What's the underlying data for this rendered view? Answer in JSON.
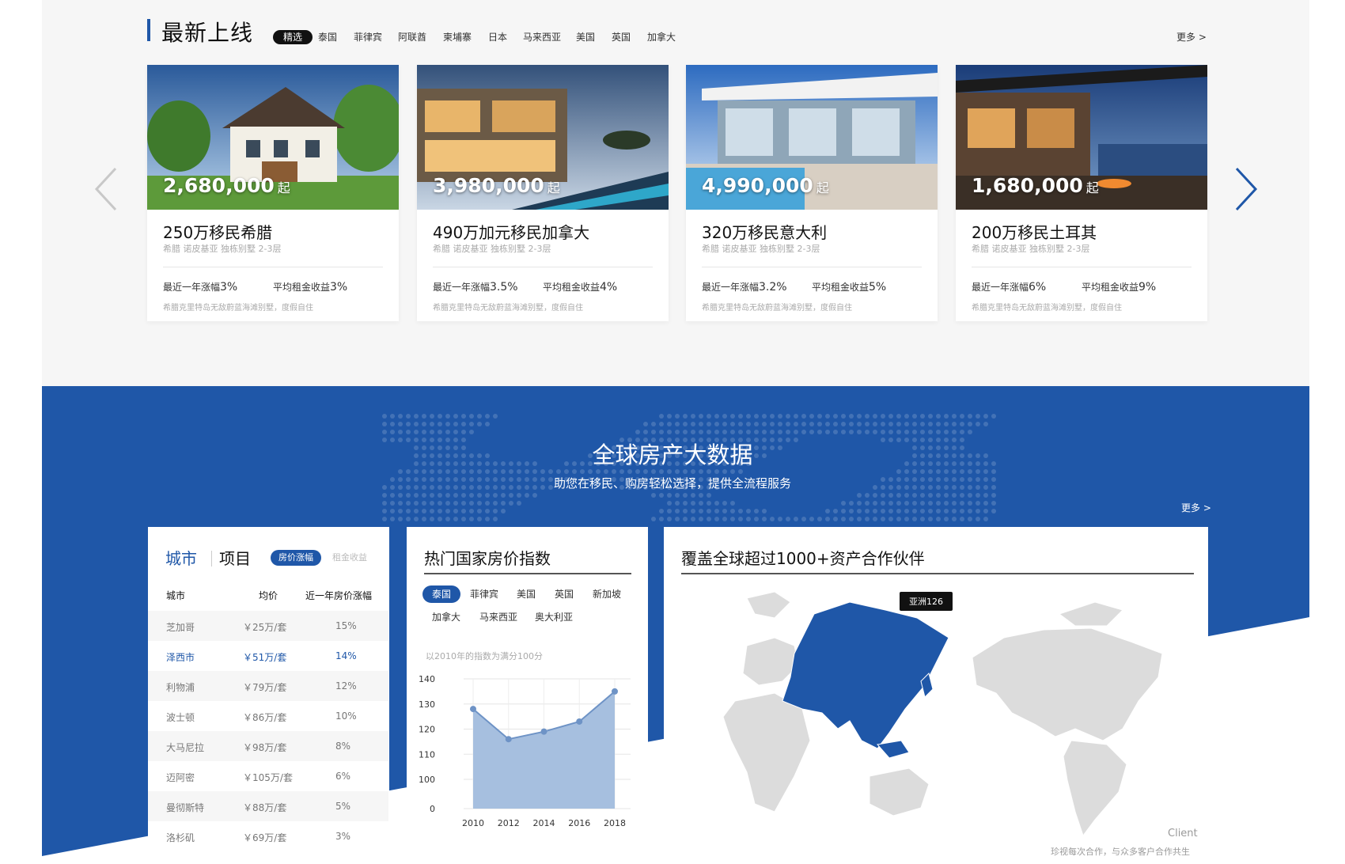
{
  "header": {
    "title": "最新上线",
    "tabs": [
      {
        "label": "精选",
        "active": true
      },
      {
        "label": "泰国"
      },
      {
        "label": "菲律宾"
      },
      {
        "label": "阿联酋"
      },
      {
        "label": "柬埔寨"
      },
      {
        "label": "日本"
      },
      {
        "label": "马来西亚"
      },
      {
        "label": "美国"
      },
      {
        "label": "英国"
      },
      {
        "label": "加拿大"
      }
    ],
    "more": "更多 >"
  },
  "carousel": {
    "prev_icon": "chevron-left-icon",
    "next_icon": "chevron-right-icon",
    "cards": [
      {
        "price": "2,680,000",
        "price_suffix": "起",
        "title": "250万移民希腊",
        "subtitle": "希腊 诺皮基亚 独栋别墅 2-3层",
        "stat1_label": "最近一年涨幅",
        "stat1_value": "3%",
        "stat2_label": "平均租金收益",
        "stat2_value": "3%",
        "note": "希腊克里特岛无敌蔚蓝海滩别墅，度假自住"
      },
      {
        "price": "3,980,000",
        "price_suffix": "起",
        "title": "490万加元移民加拿大",
        "subtitle": "希腊 诺皮基亚 独栋别墅 2-3层",
        "stat1_label": "最近一年涨幅",
        "stat1_value": "3.5%",
        "stat2_label": "平均租金收益",
        "stat2_value": "4%",
        "note": "希腊克里特岛无敌蔚蓝海滩别墅，度假自住"
      },
      {
        "price": "4,990,000",
        "price_suffix": "起",
        "title": "320万移民意大利",
        "subtitle": "希腊 诺皮基亚 独栋别墅 2-3层",
        "stat1_label": "最近一年涨幅",
        "stat1_value": "3.2%",
        "stat2_label": "平均租金收益",
        "stat2_value": "5%",
        "note": "希腊克里特岛无敌蔚蓝海滩别墅，度假自住"
      },
      {
        "price": "1,680,000",
        "price_suffix": "起",
        "title": "200万移民土耳其",
        "subtitle": "希腊 诺皮基亚 独栋别墅 2-3层",
        "stat1_label": "最近一年涨幅",
        "stat1_value": "6%",
        "stat2_label": "平均租金收益",
        "stat2_value": "9%",
        "note": "希腊克里特岛无敌蔚蓝海滩别墅，度假自住"
      }
    ]
  },
  "bigdata": {
    "title": "全球房产大数据",
    "subtitle": "助您在移民、购房轻松选择，提供全流程服务",
    "more": "更多 >"
  },
  "city_panel": {
    "tab_city": "城市",
    "tab_project": "项目",
    "toggle_active": "房价涨幅",
    "toggle_inactive": "租金收益",
    "columns": [
      "城市",
      "均价",
      "近一年房价涨幅"
    ],
    "rows": [
      {
        "city": "芝加哥",
        "price": "￥25万/套",
        "growth": "15%"
      },
      {
        "city": "泽西市",
        "price": "￥51万/套",
        "growth": "14%"
      },
      {
        "city": "利物浦",
        "price": "￥79万/套",
        "growth": "12%"
      },
      {
        "city": "波士顿",
        "price": "￥86万/套",
        "growth": "10%"
      },
      {
        "city": "大马尼拉",
        "price": "￥98万/套",
        "growth": "8%"
      },
      {
        "city": "迈阿密",
        "price": "￥105万/套",
        "growth": "6%"
      },
      {
        "city": "曼彻斯特",
        "price": "￥88万/套",
        "growth": "5%"
      },
      {
        "city": "洛杉矶",
        "price": "￥69万/套",
        "growth": "3%"
      }
    ]
  },
  "index_panel": {
    "title": "热门国家房价指数",
    "tabs": [
      {
        "label": "泰国",
        "active": true
      },
      {
        "label": "菲律宾"
      },
      {
        "label": "美国"
      },
      {
        "label": "英国"
      },
      {
        "label": "新加坡"
      },
      {
        "label": "加拿大"
      },
      {
        "label": "马来西亚"
      },
      {
        "label": "奥大利亚"
      }
    ],
    "note": "以2010年的指数为满分100分"
  },
  "chart_data": {
    "type": "area",
    "x": [
      2010,
      2011,
      2012,
      2013,
      2014,
      2015,
      2016,
      2017,
      2018
    ],
    "x_tick_labels": [
      "2010",
      "2012",
      "2014",
      "2016",
      "2018"
    ],
    "y_tick_labels": [
      "0",
      "100",
      "110",
      "120",
      "130",
      "140"
    ],
    "ylim": [
      100,
      140
    ],
    "series": [
      {
        "values": [
          128,
          null,
          116,
          null,
          119,
          null,
          123,
          null,
          135
        ]
      }
    ],
    "color": "#1f57a8",
    "fill_color": "#a6bfdf",
    "grid": true
  },
  "partner_panel": {
    "title": "覆盖全球超过1000+资产合作伙伴",
    "tooltip": "亚洲126",
    "client_label": "Client",
    "client_sub": "珍视每次合作，与众多客户合作共生"
  },
  "colors": {
    "brand": "#1f57a8",
    "background": "#f6f6f6",
    "map_land": "#dcdcdc"
  }
}
